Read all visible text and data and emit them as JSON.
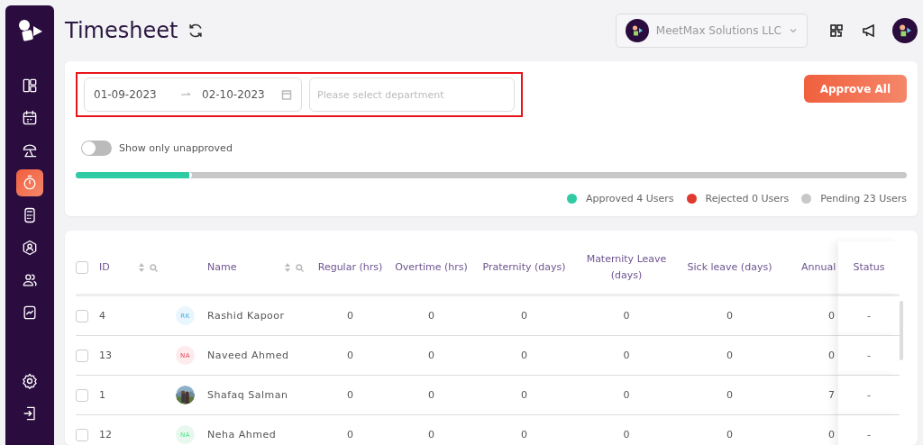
{
  "sidebar": {
    "items": [
      {
        "selected": false
      },
      {
        "selected": false
      },
      {
        "selected": false
      },
      {
        "selected": true
      },
      {
        "selected": false
      },
      {
        "selected": false
      },
      {
        "selected": false
      },
      {
        "selected": false
      }
    ]
  },
  "header": {
    "title": "Timesheet",
    "company": "MeetMax Solutions LLC"
  },
  "filters": {
    "date_from": "01-09-2023",
    "date_to": "02-10-2023",
    "department": {
      "placeholder": "Please select department"
    },
    "approve_button": "Approve All",
    "toggle": {
      "label": "Show only unapproved",
      "on": false
    }
  },
  "progress": {
    "level": 0.14
  },
  "legend": [
    {
      "label": "Approved 4 Users",
      "color": "#2ecba4"
    },
    {
      "label": "Rejected 0 Users",
      "color": "#e0392f"
    },
    {
      "label": "Pending 23 Users",
      "color": "#c8c8c8"
    }
  ],
  "table": {
    "all_checked": false,
    "columns": [
      {
        "label": "ID"
      },
      {
        "label": "Name"
      },
      {
        "label": "Regular (hrs)"
      },
      {
        "label": "Overtime (hrs)"
      },
      {
        "label": "Praternity (days)"
      },
      {
        "label": "Maternity Leave (days)"
      },
      {
        "label": "Sick leave (days)"
      },
      {
        "label": "Annual"
      },
      {
        "label": "Status"
      }
    ],
    "rows": [
      {
        "checked": false,
        "id": "4",
        "avatar": {
          "kind": "initials",
          "text": "RK",
          "color": "#eaf6fd"
        },
        "name": "Rashid Kapoor",
        "values": [
          "0",
          "0",
          "0",
          "0",
          "0",
          "0"
        ],
        "status": "-"
      },
      {
        "checked": false,
        "id": "13",
        "avatar": {
          "kind": "initials",
          "text": "NA",
          "color": "#fdebed"
        },
        "name": "Naveed Ahmed",
        "values": [
          "0",
          "0",
          "0",
          "0",
          "0",
          "0"
        ],
        "status": "-"
      },
      {
        "checked": false,
        "id": "1",
        "name": "Shafaq Salman",
        "values": [
          "0",
          "0",
          "0",
          "0",
          "0",
          "7"
        ],
        "status": "-"
      },
      {
        "checked": false,
        "id": "12",
        "avatar": {
          "kind": "initials",
          "text": "NA",
          "color": "#e9f8ef"
        },
        "name": "Neha Ahmed",
        "values": [
          "0",
          "0",
          "0",
          "0",
          "0",
          "0"
        ],
        "status": "-"
      }
    ]
  }
}
